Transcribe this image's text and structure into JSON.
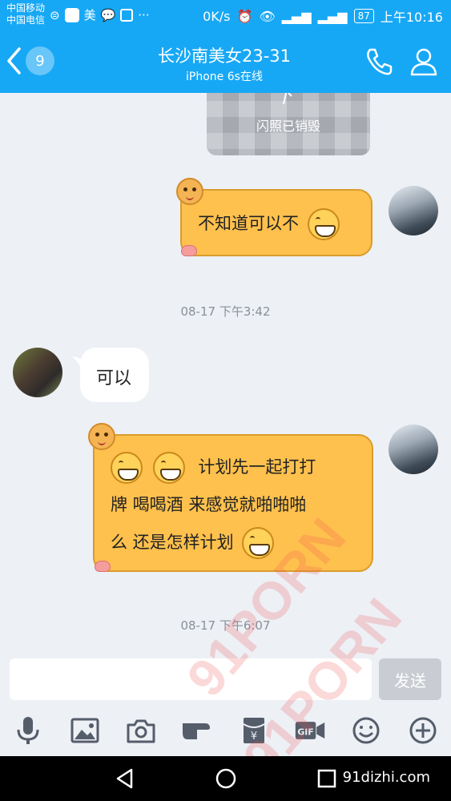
{
  "status_bar": {
    "carrier1": "中国移动",
    "carrier2": "中国电信",
    "app_label": "美",
    "more": "···",
    "speed": "0K/s",
    "battery": "87",
    "time": "上午10:16"
  },
  "header": {
    "back_count": "9",
    "title": "长沙南美女23-31",
    "subtitle": "iPhone 6s在线"
  },
  "messages": [
    {
      "from": "me",
      "type": "flash_photo",
      "text": "闪照已销毁"
    },
    {
      "from": "me",
      "type": "text",
      "text": "不知道可以不",
      "emoji": "grin"
    },
    {
      "type": "timestamp",
      "text": "08-17 下午3:42"
    },
    {
      "from": "them",
      "type": "text",
      "text": "可以"
    },
    {
      "from": "me",
      "type": "text",
      "line1": "计划先一起打打",
      "line2": "牌 喝喝酒 来感觉就啪啪啪",
      "line3": "么 还是怎样计划",
      "emoji": "grin"
    },
    {
      "type": "timestamp",
      "text": "08-17 下午6:07"
    }
  ],
  "input": {
    "placeholder": "",
    "send_label": "发送"
  },
  "toolbar": [
    "mic-icon",
    "image-icon",
    "camera-icon",
    "poke-icon",
    "red-packet-icon",
    "gif-icon",
    "emoji-icon",
    "plus-icon"
  ],
  "nav": {
    "site": "91dizhi.com"
  },
  "watermark": {
    "text1": "91PORN",
    "text2": "91PORN"
  },
  "colors": {
    "accent": "#17a8f5",
    "bubble": "#ffc14d",
    "background": "#edf0f5"
  }
}
